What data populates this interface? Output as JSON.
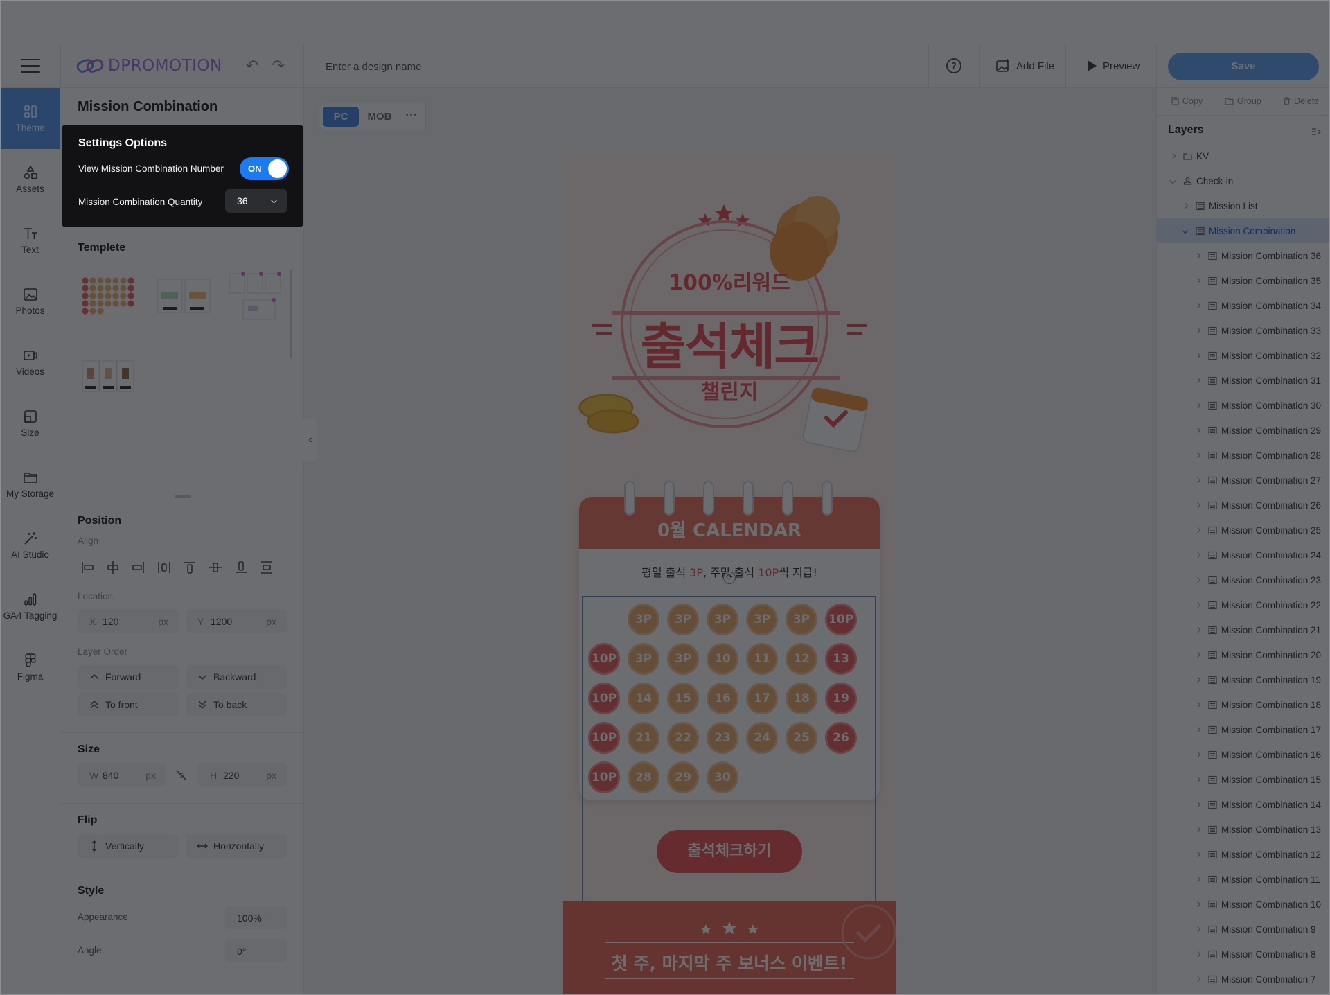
{
  "header": {
    "logo_text": "DPROMOTION",
    "design_name_placeholder": "Enter a design name",
    "add_file_label": "Add File",
    "preview_label": "Preview",
    "save_label": "Save"
  },
  "rail": {
    "items": [
      {
        "label": "Theme",
        "icon": "theme-icon",
        "active": true
      },
      {
        "label": "Assets",
        "icon": "assets-icon"
      },
      {
        "label": "Text",
        "icon": "text-icon"
      },
      {
        "label": "Photos",
        "icon": "photos-icon"
      },
      {
        "label": "Videos",
        "icon": "videos-icon"
      },
      {
        "label": "Size",
        "icon": "size-icon"
      },
      {
        "label": "My Storage",
        "icon": "folder-icon"
      },
      {
        "label": "AI Studio",
        "icon": "magic-wand-icon"
      },
      {
        "label": "GA4 Tagging",
        "icon": "bar-chart-icon"
      },
      {
        "label": "Figma",
        "icon": "figma-icon"
      }
    ]
  },
  "panel": {
    "title": "Mission Combination",
    "settings": {
      "title": "Settings Options",
      "view_number_label": "View Mission Combination Number",
      "toggle_label": "ON",
      "quantity_label": "Mission Combination Quantity",
      "quantity_value": "36"
    },
    "template_title": "Templete",
    "position": {
      "title": "Position",
      "align_label": "Align",
      "location_label": "Location",
      "x_key": "X",
      "x_value": "120",
      "x_unit": "px",
      "y_key": "Y",
      "y_value": "1200",
      "y_unit": "px",
      "layer_order_label": "Layer Order",
      "forward": "Forward",
      "backward": "Backward",
      "to_front": "To front",
      "to_back": "To back"
    },
    "size": {
      "title": "Size",
      "w_key": "W",
      "w_value": "840",
      "w_unit": "px",
      "h_key": "H",
      "h_value": "220",
      "h_unit": "px"
    },
    "flip": {
      "title": "Flip",
      "vertically": "Vertically",
      "horizontally": "Horizontally"
    },
    "style": {
      "title": "Style",
      "appearance_label": "Appearance",
      "appearance_value": "100%",
      "angle_label": "Angle",
      "angle_value": "0°"
    }
  },
  "canvas": {
    "tab_pc": "PC",
    "tab_mob": "MOB",
    "more": "···",
    "design": {
      "reward_text": "100%리워드",
      "headline": "출석체크",
      "sub": "챌린지",
      "calendar_title": "0월 CALENDAR",
      "notice_pre": "평일 출석 ",
      "notice_3p": "3P",
      "notice_mid": ", 주말 출석 ",
      "notice_10p": "10P",
      "notice_post": "씩 지급!",
      "stamps": [
        "3P",
        "3P",
        "3P",
        "3P",
        "3P",
        "10P",
        "10P",
        "3P",
        "3P",
        "10",
        "11",
        "12",
        "13",
        "10P",
        "14",
        "15",
        "16",
        "17",
        "18",
        "19",
        "10P",
        "21",
        "22",
        "23",
        "24",
        "25",
        "26",
        "10P",
        "28",
        "29",
        "30"
      ],
      "cta_label": "출석체크하기",
      "bonus_text": "첫 주, 마지막 주 보너스 이벤트!"
    }
  },
  "right": {
    "copy": "Copy",
    "group": "Group",
    "delete": "Delete",
    "layers_title": "Layers",
    "layers": [
      {
        "name": "KV",
        "depth": 0,
        "type": "folder"
      },
      {
        "name": "Check-in",
        "depth": 0,
        "type": "stamp",
        "open": true
      },
      {
        "name": "Mission List",
        "depth": 1,
        "type": "list"
      },
      {
        "name": "Mission Combination",
        "depth": 1,
        "type": "list",
        "open": true,
        "selected": true
      },
      {
        "name": "Mission Combination 36",
        "depth": 2,
        "type": "list"
      },
      {
        "name": "Mission Combination 35",
        "depth": 2,
        "type": "list"
      },
      {
        "name": "Mission Combination 34",
        "depth": 2,
        "type": "list"
      },
      {
        "name": "Mission Combination 33",
        "depth": 2,
        "type": "list"
      },
      {
        "name": "Mission Combination 32",
        "depth": 2,
        "type": "list"
      },
      {
        "name": "Mission Combination 31",
        "depth": 2,
        "type": "list"
      },
      {
        "name": "Mission Combination 30",
        "depth": 2,
        "type": "list"
      },
      {
        "name": "Mission Combination 29",
        "depth": 2,
        "type": "list"
      },
      {
        "name": "Mission Combination 28",
        "depth": 2,
        "type": "list"
      },
      {
        "name": "Mission Combination 27",
        "depth": 2,
        "type": "list"
      },
      {
        "name": "Mission Combination 26",
        "depth": 2,
        "type": "list"
      },
      {
        "name": "Mission Combination 25",
        "depth": 2,
        "type": "list"
      },
      {
        "name": "Mission Combination 24",
        "depth": 2,
        "type": "list"
      },
      {
        "name": "Mission Combination 23",
        "depth": 2,
        "type": "list"
      },
      {
        "name": "Mission Combination 22",
        "depth": 2,
        "type": "list"
      },
      {
        "name": "Mission Combination 21",
        "depth": 2,
        "type": "list"
      },
      {
        "name": "Mission Combination 20",
        "depth": 2,
        "type": "list"
      },
      {
        "name": "Mission Combination 19",
        "depth": 2,
        "type": "list"
      },
      {
        "name": "Mission Combination 18",
        "depth": 2,
        "type": "list"
      },
      {
        "name": "Mission Combination 17",
        "depth": 2,
        "type": "list"
      },
      {
        "name": "Mission Combination 16",
        "depth": 2,
        "type": "list"
      },
      {
        "name": "Mission Combination 15",
        "depth": 2,
        "type": "list"
      },
      {
        "name": "Mission Combination 14",
        "depth": 2,
        "type": "list"
      },
      {
        "name": "Mission Combination 13",
        "depth": 2,
        "type": "list"
      },
      {
        "name": "Mission Combination 12",
        "depth": 2,
        "type": "list"
      },
      {
        "name": "Mission Combination 11",
        "depth": 2,
        "type": "list"
      },
      {
        "name": "Mission Combination 10",
        "depth": 2,
        "type": "list"
      },
      {
        "name": "Mission Combination 9",
        "depth": 2,
        "type": "list"
      },
      {
        "name": "Mission Combination 8",
        "depth": 2,
        "type": "list"
      },
      {
        "name": "Mission Combination 7",
        "depth": 2,
        "type": "list"
      }
    ]
  },
  "colors": {
    "accent": "#1a7cf4",
    "save": "#6aa8f7",
    "stamp_orange": "#f0b070",
    "stamp_red": "#ee6464",
    "brand_coral": "#f07a6a"
  }
}
